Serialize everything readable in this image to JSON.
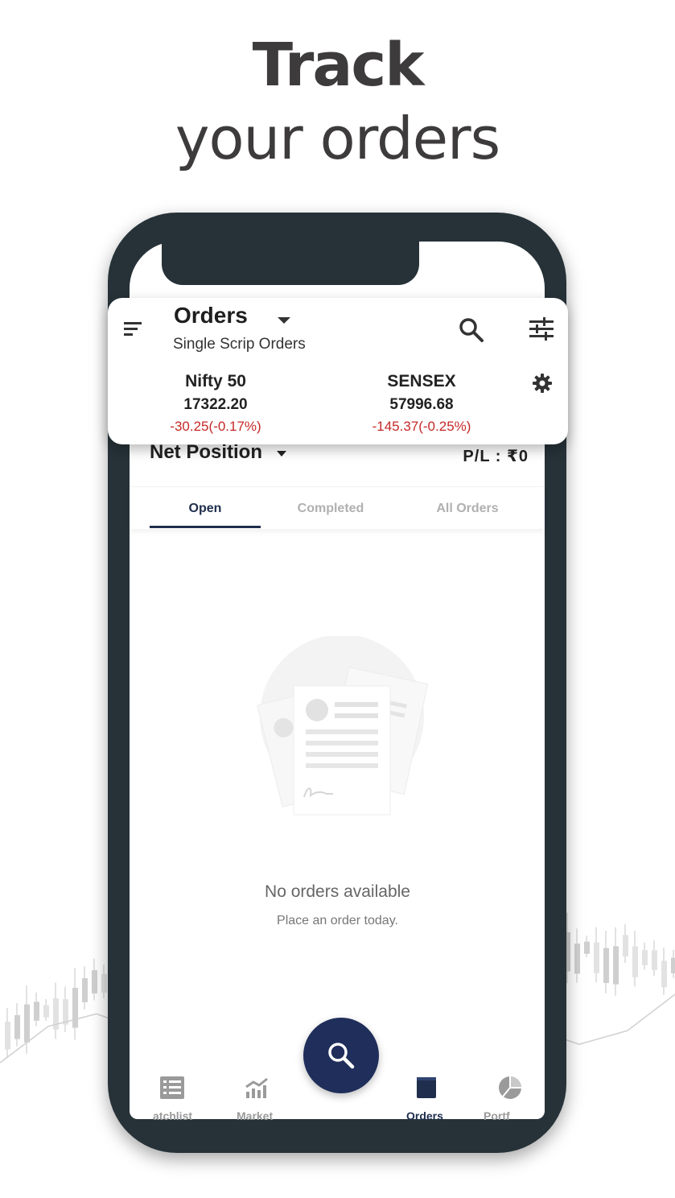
{
  "promo": {
    "line1": "Track",
    "line2": "your orders"
  },
  "header": {
    "title": "Orders",
    "subtitle": "Single Scrip Orders",
    "indices": [
      {
        "name": "Nifty 50",
        "value": "17322.20",
        "change": "-30.25(-0.17%)"
      },
      {
        "name": "SENSEX",
        "value": "57996.68",
        "change": "-145.37(-0.25%)"
      }
    ]
  },
  "position": {
    "label": "Net Position",
    "pl": "P/L : ₹0"
  },
  "tabs": [
    {
      "label": "Open",
      "active": true
    },
    {
      "label": "Completed",
      "active": false
    },
    {
      "label": "All Orders",
      "active": false
    }
  ],
  "empty": {
    "title": "No orders available",
    "subtitle": "Place an order today."
  },
  "bottom_nav": {
    "items": [
      {
        "label": "atchlist",
        "icon": "list-icon"
      },
      {
        "label": "Market",
        "icon": "trend-icon"
      },
      {
        "label": "Orders",
        "icon": "book-icon"
      },
      {
        "label": "Portf",
        "icon": "pie-chart-icon"
      }
    ]
  },
  "colors": {
    "accent": "#1f2e4d",
    "negative": "#c62828",
    "frame": "#263238"
  }
}
